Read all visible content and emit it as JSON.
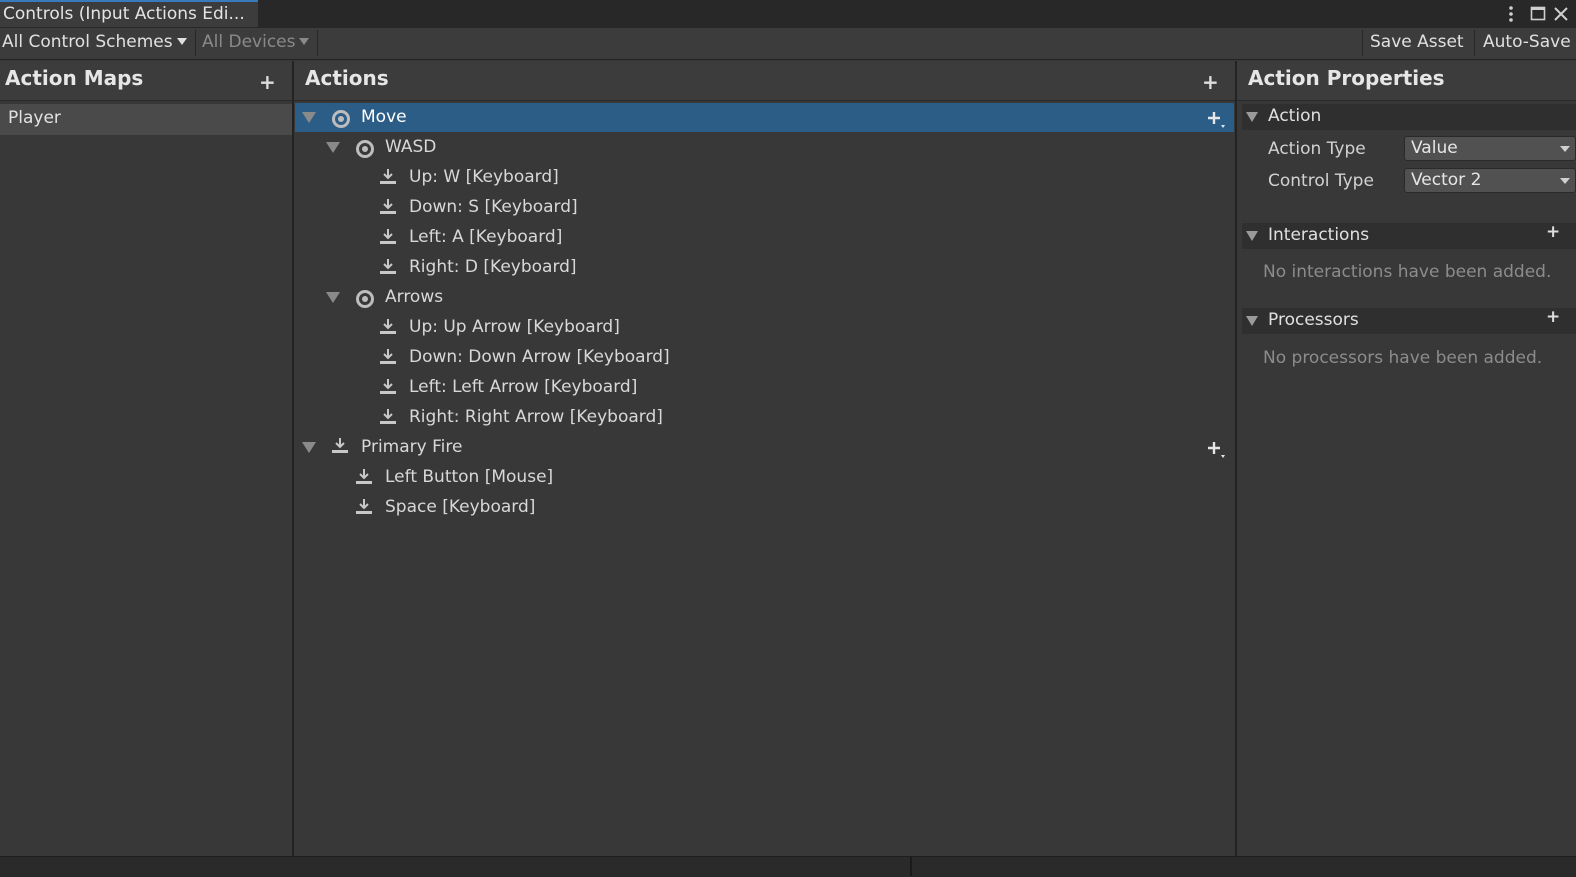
{
  "window": {
    "tab_title": "Controls (Input Actions Edi...",
    "menu_icon": "kebab-menu-icon",
    "maximize_icon": "maximize-icon",
    "close_icon": "close-icon"
  },
  "toolbar": {
    "control_schemes": "All Control Schemes",
    "devices": "All Devices",
    "save_asset": "Save Asset",
    "auto_save": "Auto-Save"
  },
  "action_maps": {
    "title": "Action Maps",
    "add_symbol": "+",
    "items": [
      {
        "label": "Player"
      }
    ]
  },
  "actions": {
    "title": "Actions",
    "add_symbol": "+",
    "tree": [
      {
        "label": "Move",
        "kind": "action"
      },
      {
        "label": "WASD",
        "kind": "composite"
      },
      {
        "label": "Up: W [Keyboard]",
        "kind": "binding"
      },
      {
        "label": "Down: S [Keyboard]",
        "kind": "binding"
      },
      {
        "label": "Left: A [Keyboard]",
        "kind": "binding"
      },
      {
        "label": "Right: D [Keyboard]",
        "kind": "binding"
      },
      {
        "label": "Arrows",
        "kind": "composite"
      },
      {
        "label": "Up: Up Arrow [Keyboard]",
        "kind": "binding"
      },
      {
        "label": "Down: Down Arrow [Keyboard]",
        "kind": "binding"
      },
      {
        "label": "Left: Left Arrow [Keyboard]",
        "kind": "binding"
      },
      {
        "label": "Right: Right Arrow [Keyboard]",
        "kind": "binding"
      },
      {
        "label": "Primary Fire",
        "kind": "action"
      },
      {
        "label": "Left Button [Mouse]",
        "kind": "binding"
      },
      {
        "label": "Space [Keyboard]",
        "kind": "binding"
      }
    ]
  },
  "properties": {
    "title": "Action Properties",
    "action_section": "Action",
    "action_type_label": "Action Type",
    "action_type_value": "Value",
    "control_type_label": "Control Type",
    "control_type_value": "Vector 2",
    "interactions_section": "Interactions",
    "interactions_empty": "No interactions have been added.",
    "processors_section": "Processors",
    "processors_empty": "No processors have been added.",
    "add_symbol": "+"
  },
  "colors": {
    "background": "#383838",
    "selection": "#2c5d87",
    "tab_accent": "#3a79bb"
  }
}
